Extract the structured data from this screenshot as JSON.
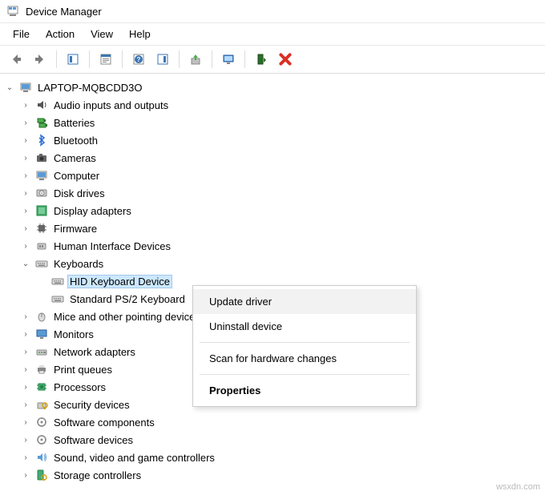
{
  "window": {
    "title": "Device Manager"
  },
  "menu": {
    "file": "File",
    "action": "Action",
    "view": "View",
    "help": "Help"
  },
  "root_label": "LAPTOP-MQBCDD3O",
  "categories": [
    {
      "label": "Audio inputs and outputs",
      "icon": "speaker"
    },
    {
      "label": "Batteries",
      "icon": "battery"
    },
    {
      "label": "Bluetooth",
      "icon": "bluetooth"
    },
    {
      "label": "Cameras",
      "icon": "camera"
    },
    {
      "label": "Computer",
      "icon": "computer"
    },
    {
      "label": "Disk drives",
      "icon": "disk"
    },
    {
      "label": "Display adapters",
      "icon": "display"
    },
    {
      "label": "Firmware",
      "icon": "chip"
    },
    {
      "label": "Human Interface Devices",
      "icon": "hid"
    },
    {
      "label": "Keyboards",
      "icon": "keyboard",
      "expanded": true
    },
    {
      "label": "Mice and other pointing devices",
      "icon": "mouse"
    },
    {
      "label": "Monitors",
      "icon": "monitor"
    },
    {
      "label": "Network adapters",
      "icon": "network"
    },
    {
      "label": "Print queues",
      "icon": "printer"
    },
    {
      "label": "Processors",
      "icon": "cpu"
    },
    {
      "label": "Security devices",
      "icon": "security"
    },
    {
      "label": "Software components",
      "icon": "software"
    },
    {
      "label": "Software devices",
      "icon": "software"
    },
    {
      "label": "Sound, video and game controllers",
      "icon": "sound"
    },
    {
      "label": "Storage controllers",
      "icon": "storage"
    }
  ],
  "keyboard_children": [
    {
      "label": "HID Keyboard Device",
      "selected": true
    },
    {
      "label": "Standard PS/2 Keyboard",
      "selected": false
    }
  ],
  "context_menu": {
    "update": "Update driver",
    "uninstall": "Uninstall device",
    "scan": "Scan for hardware changes",
    "properties": "Properties"
  },
  "watermark": "wsxdn.com"
}
